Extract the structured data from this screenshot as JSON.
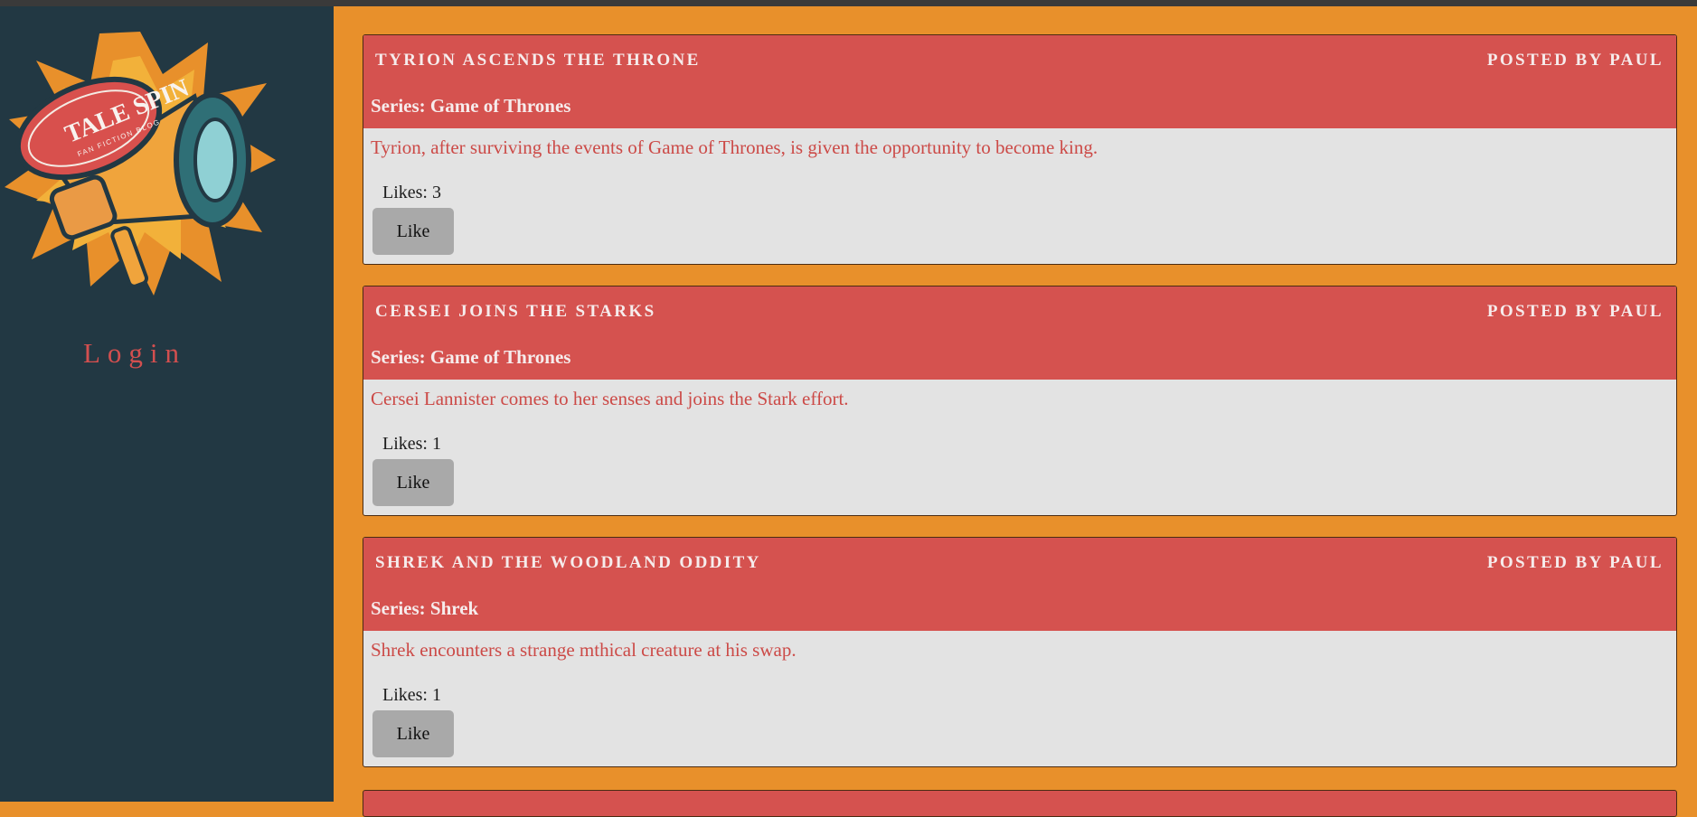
{
  "sidebar": {
    "logo_text": "TALE SPIN",
    "logo_subtext": "FAN FICTION BLOG",
    "login_label": "Login"
  },
  "posts": [
    {
      "title": "Tyrion Ascends the Throne",
      "author": "Posted by Paul",
      "series": "Series: Game of Thrones",
      "description": "Tyrion, after surviving the events of Game of Thrones, is given the opportunity to become king.",
      "likes": "Likes: 3",
      "like_label": "Like"
    },
    {
      "title": "Cersei Joins the Starks",
      "author": "Posted by Paul",
      "series": "Series: Game of Thrones",
      "description": "Cersei Lannister comes to her senses and joins the Stark effort.",
      "likes": "Likes: 1",
      "like_label": "Like"
    },
    {
      "title": "Shrek and the Woodland Oddity",
      "author": "Posted by Paul",
      "series": "Series: Shrek",
      "description": "Shrek encounters a strange mthical creature at his swap.",
      "likes": "Likes: 1",
      "like_label": "Like"
    }
  ],
  "colors": {
    "background": "#e8902b",
    "sidebar": "#223843",
    "header": "#d5524f",
    "accent_text": "#d34f4f",
    "card_body": "#e3e3e3",
    "button": "#a9a9a9"
  }
}
